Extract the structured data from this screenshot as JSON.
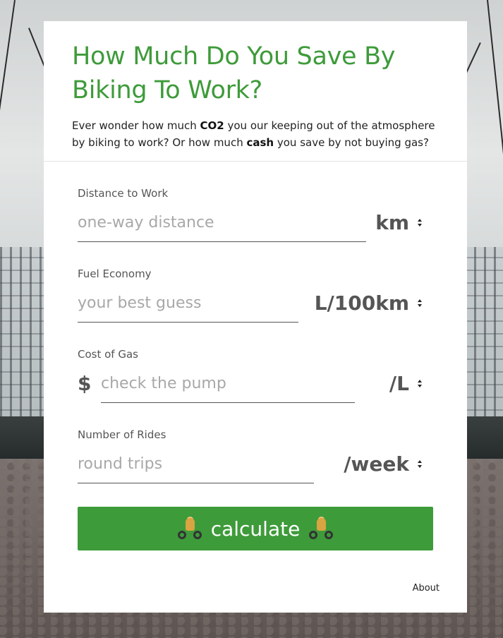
{
  "header": {
    "title": "How Much Do You Save By Biking To Work?",
    "intro_part1": "Ever wonder how much ",
    "intro_bold1": "CO2",
    "intro_part2": " you our keeping out of the atmosphere by biking to work? Or how much ",
    "intro_bold2": "cash",
    "intro_part3": " you save by not buying gas?"
  },
  "fields": {
    "distance": {
      "label": "Distance to Work",
      "placeholder": "one-way distance",
      "value": "",
      "unit": "km"
    },
    "economy": {
      "label": "Fuel Economy",
      "placeholder": "your best guess",
      "value": "",
      "unit": "L/100km"
    },
    "gas": {
      "label": "Cost of Gas",
      "currency": "$",
      "placeholder": "check the pump",
      "value": "",
      "unit": "/L"
    },
    "rides": {
      "label": "Number of Rides",
      "placeholder": "round trips",
      "value": "",
      "unit": "/week"
    }
  },
  "button": {
    "label": "calculate",
    "icon": "bicyclist-icon"
  },
  "footer": {
    "about": "About"
  },
  "colors": {
    "accent": "#3e9b3a",
    "card": "#ffffff",
    "text": "#222222",
    "muted": "#555555"
  }
}
